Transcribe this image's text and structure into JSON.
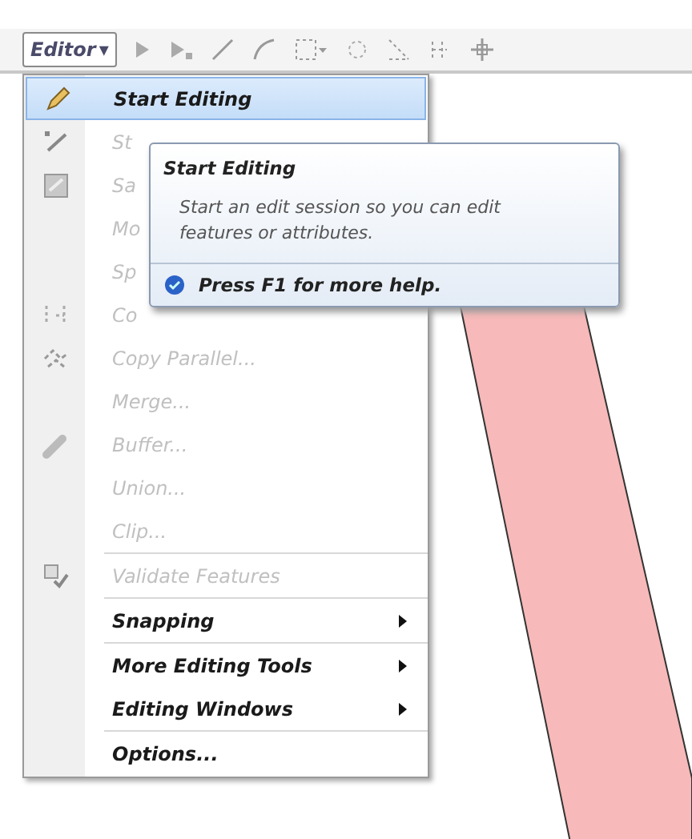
{
  "toolbar": {
    "editor_button": {
      "label": "Editor",
      "caret": "▾"
    }
  },
  "menu": {
    "items": [
      {
        "label": "Start Editing",
        "disabled": false,
        "highlighted": true,
        "submenu": false,
        "separator_before": false
      },
      {
        "label": "St",
        "disabled": true,
        "highlighted": false,
        "submenu": false,
        "separator_before": false
      },
      {
        "label": "Sa",
        "disabled": true,
        "highlighted": false,
        "submenu": false,
        "separator_before": false
      },
      {
        "label": "Mo",
        "disabled": true,
        "highlighted": false,
        "submenu": false,
        "separator_before": false
      },
      {
        "label": "Sp",
        "disabled": true,
        "highlighted": false,
        "submenu": false,
        "separator_before": false
      },
      {
        "label": "Co",
        "disabled": true,
        "highlighted": false,
        "submenu": false,
        "separator_before": false
      },
      {
        "label": "Copy Parallel...",
        "disabled": true,
        "highlighted": false,
        "submenu": false,
        "separator_before": false
      },
      {
        "label": "Merge...",
        "disabled": true,
        "highlighted": false,
        "submenu": false,
        "separator_before": false
      },
      {
        "label": "Buffer...",
        "disabled": true,
        "highlighted": false,
        "submenu": false,
        "separator_before": false
      },
      {
        "label": "Union...",
        "disabled": true,
        "highlighted": false,
        "submenu": false,
        "separator_before": false
      },
      {
        "label": "Clip...",
        "disabled": true,
        "highlighted": false,
        "submenu": false,
        "separator_before": false
      },
      {
        "label": "Validate Features",
        "disabled": true,
        "highlighted": false,
        "submenu": false,
        "separator_before": true
      },
      {
        "label": "Snapping",
        "disabled": false,
        "highlighted": false,
        "submenu": true,
        "separator_before": true
      },
      {
        "label": "More Editing Tools",
        "disabled": false,
        "highlighted": false,
        "submenu": true,
        "separator_before": true
      },
      {
        "label": "Editing Windows",
        "disabled": false,
        "highlighted": false,
        "submenu": true,
        "separator_before": false
      },
      {
        "label": "Options...",
        "disabled": false,
        "highlighted": false,
        "submenu": false,
        "separator_before": true
      }
    ]
  },
  "tooltip": {
    "title": "Start Editing",
    "body": "Start an edit session so you can edit features or attributes.",
    "help": "Press F1 for more help."
  }
}
